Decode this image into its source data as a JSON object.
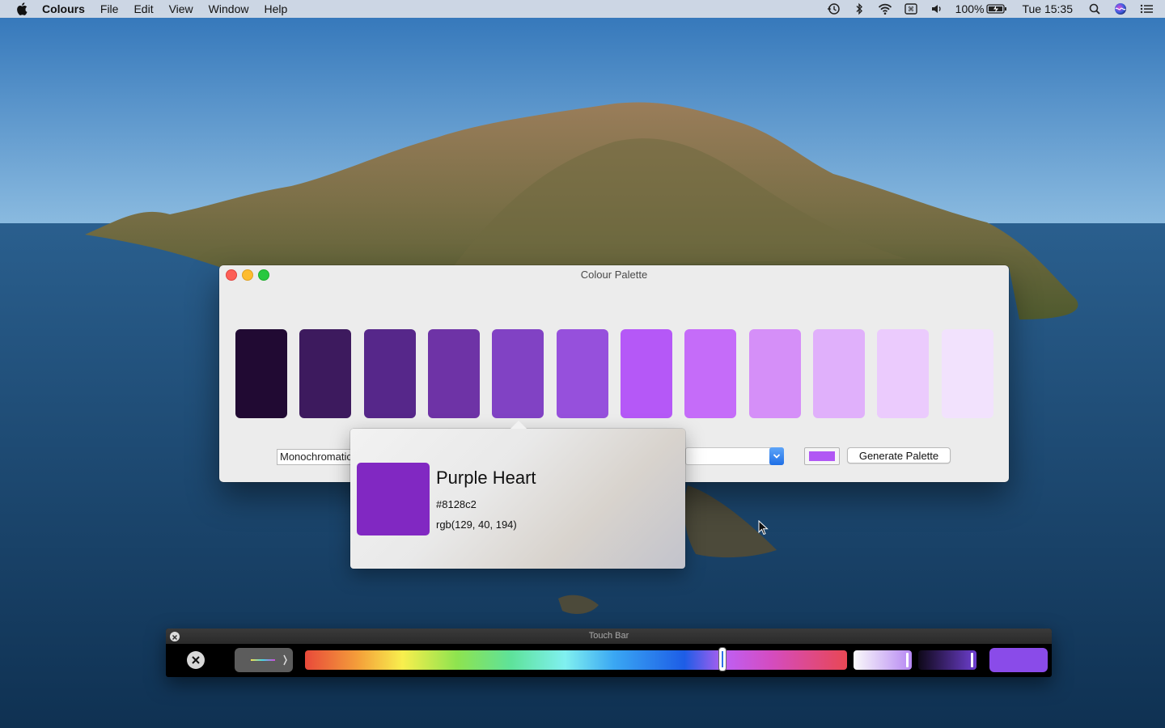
{
  "menubar": {
    "app_name": "Colours",
    "menus": [
      "File",
      "Edit",
      "View",
      "Window",
      "Help"
    ],
    "battery": "100%",
    "clock": "Tue 15:35",
    "status_icons": [
      "time-machine-icon",
      "bluetooth-icon",
      "wifi-icon",
      "input-menu-icon",
      "volume-icon",
      "battery-icon",
      "spotlight-icon",
      "siri-icon",
      "notification-center-icon"
    ]
  },
  "window": {
    "title": "Colour Palette",
    "palette": [
      "#210a33",
      "#3d1a5e",
      "#56278a",
      "#6e33a6",
      "#8142c4",
      "#9650dc",
      "#b558f7",
      "#c56cf9",
      "#d58ff8",
      "#e0b0fb",
      "#ebcbfd",
      "#f2e2fd"
    ],
    "mode_value": "Monochromatic",
    "base_colour": "#b158f4",
    "generate_label": "Generate Palette"
  },
  "popover": {
    "name": "Purple Heart",
    "hex": "#8128c2",
    "rgb": "rgb(129, 40, 194)",
    "colour": "#8128c2"
  },
  "touchbar": {
    "title": "Touch Bar",
    "hue_position": 0.77,
    "preview_colour": "#8a4be9"
  }
}
